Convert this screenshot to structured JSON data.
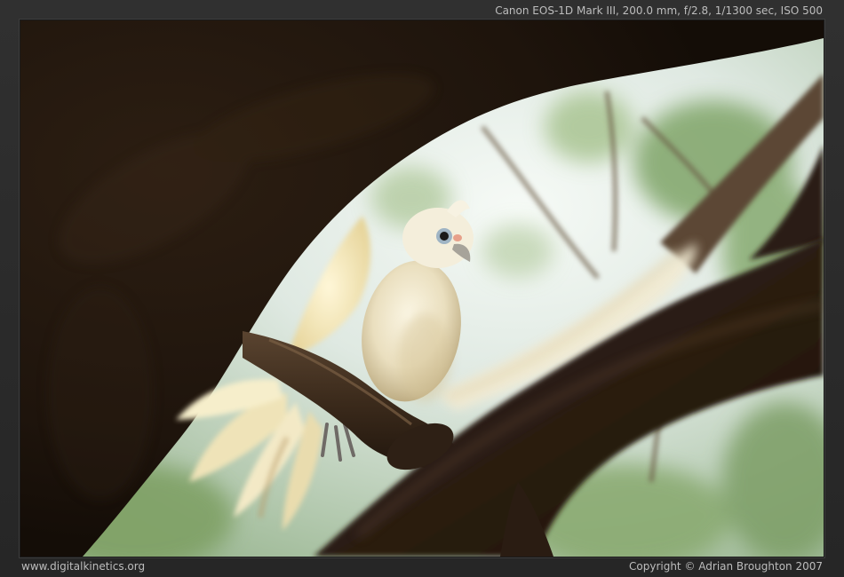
{
  "exif": "Canon EOS-1D Mark III, 200.0 mm, f/2.8, 1/1300 sec, ISO 500",
  "website": "www.digitalkinetics.org",
  "copyright": "Copyright © Adrian Broughton 2007",
  "colors": {
    "frame": "#2a2a2a",
    "caption_text": "#bdbdbd",
    "sky": "#e6efe9",
    "foliage": "#8fb37a",
    "bark_dark": "#1e140c",
    "bird": "#f0ead4",
    "bird_shadow": "#cdbf98"
  }
}
